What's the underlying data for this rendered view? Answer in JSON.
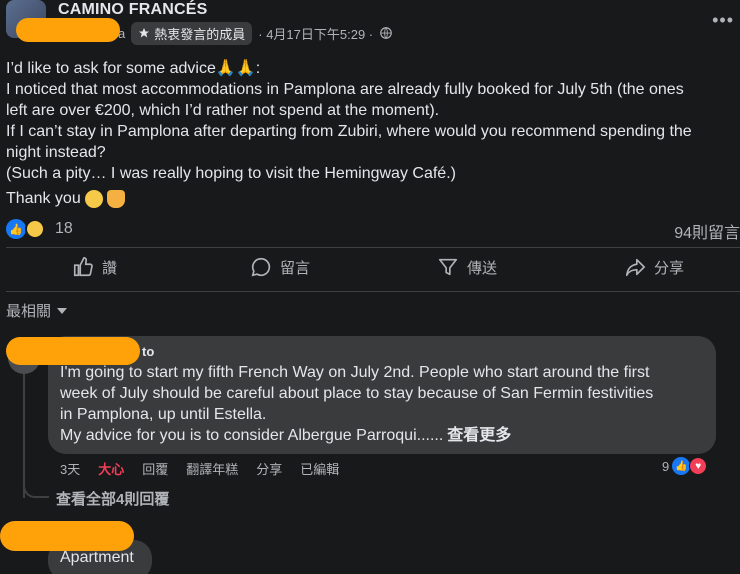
{
  "header": {
    "group_name": "CAMINO FRANCÉS",
    "name_suffix": "a",
    "badge_label": "熱衷發言的成員",
    "timestamp": "· 4月17日下午5:29 ·",
    "more_label": "•••"
  },
  "post": {
    "lines": [
      "I’d like to ask for some advice🙏🙏:",
      "I noticed that most accommodations in Pamplona are already fully booked for July 5th (the ones",
      "left are over €200, which I’d rather not spend at the moment).",
      "If I can’t stay in Pamplona after departing from Zubiri, where would you recommend spending the",
      "night instead?",
      "(Such a pity… I was really hoping to visit the Hemingway Café.)"
    ],
    "thanks": "Thank you"
  },
  "stats": {
    "reaction_count": "18",
    "comment_count": "94則留言"
  },
  "actions": {
    "like": "讚",
    "comment": "留言",
    "send": "傳送",
    "share": "分享"
  },
  "sort": {
    "label": "最相關"
  },
  "comment": {
    "author_suffix": "to",
    "lines": [
      "I'm going to start my fifth French Way on July 2nd. People who start around the first",
      "week of July should be careful about place to stay because of San Fermin festivities",
      "in Pamplona, up until Estella.",
      "My advice for you is to consider Albergue Parroqui......"
    ],
    "see_more": "查看更多",
    "time": "3天",
    "love": "大心",
    "reply": "回覆",
    "translate": "翻譯年糕",
    "share": "分享",
    "edited": "已編輯",
    "reaction_count": "9",
    "view_replies": "查看全部4則回覆"
  },
  "comment2": {
    "text": "Apartment"
  }
}
